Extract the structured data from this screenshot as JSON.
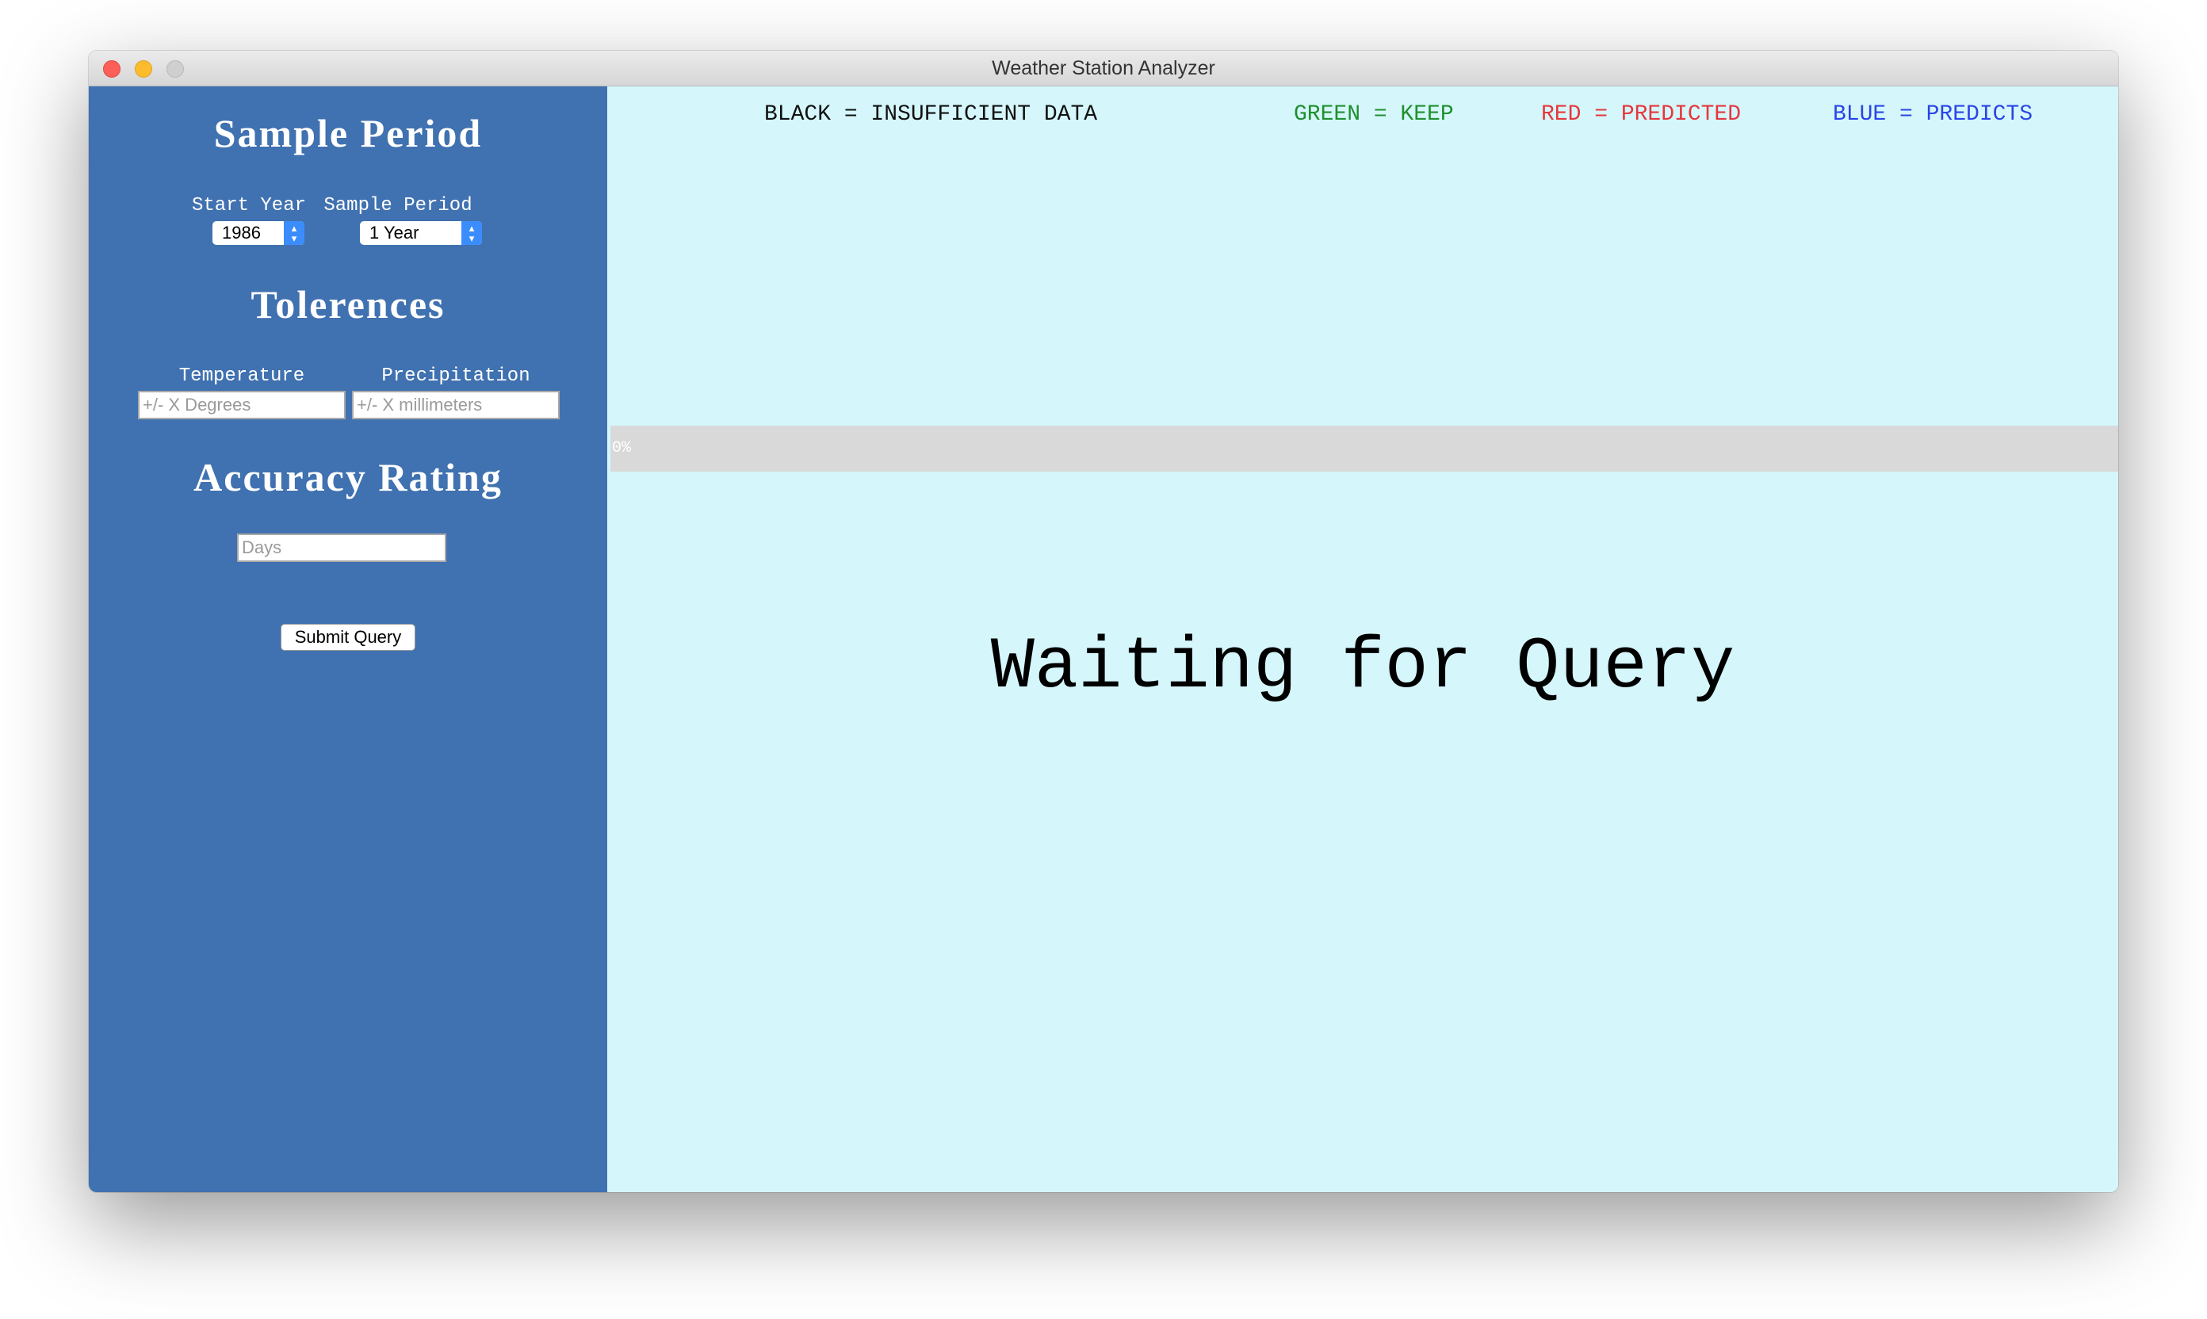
{
  "window": {
    "title": "Weather Station Analyzer"
  },
  "sidebar": {
    "sample_period": {
      "heading": "Sample Period",
      "start_year_label": "Start Year",
      "start_year_value": "1986",
      "sample_period_label": "Sample Period",
      "sample_period_value": "1 Year"
    },
    "tolerances": {
      "heading": "Tolerences",
      "temperature_label": "Temperature",
      "temperature_placeholder": "+/- X Degrees",
      "precipitation_label": "Precipitation",
      "precipitation_placeholder": "+/- X millimeters"
    },
    "accuracy": {
      "heading": "Accuracy Rating",
      "days_placeholder": "Days",
      "submit_label": "Submit Query"
    }
  },
  "legend": {
    "black": "BLACK = INSUFFICIENT DATA",
    "green": "GREEN = KEEP",
    "red": "RED = PREDICTED",
    "blue": "BLUE = PREDICTS"
  },
  "colors": {
    "black": "#111111",
    "green": "#1f8f2e",
    "red": "#e5373e",
    "blue": "#2a45e6",
    "sidebar": "#4071b0",
    "main_bg": "#d5f7fb"
  },
  "progress": {
    "value": 0,
    "label": "0%"
  },
  "status": {
    "message": "Waiting for Query"
  }
}
